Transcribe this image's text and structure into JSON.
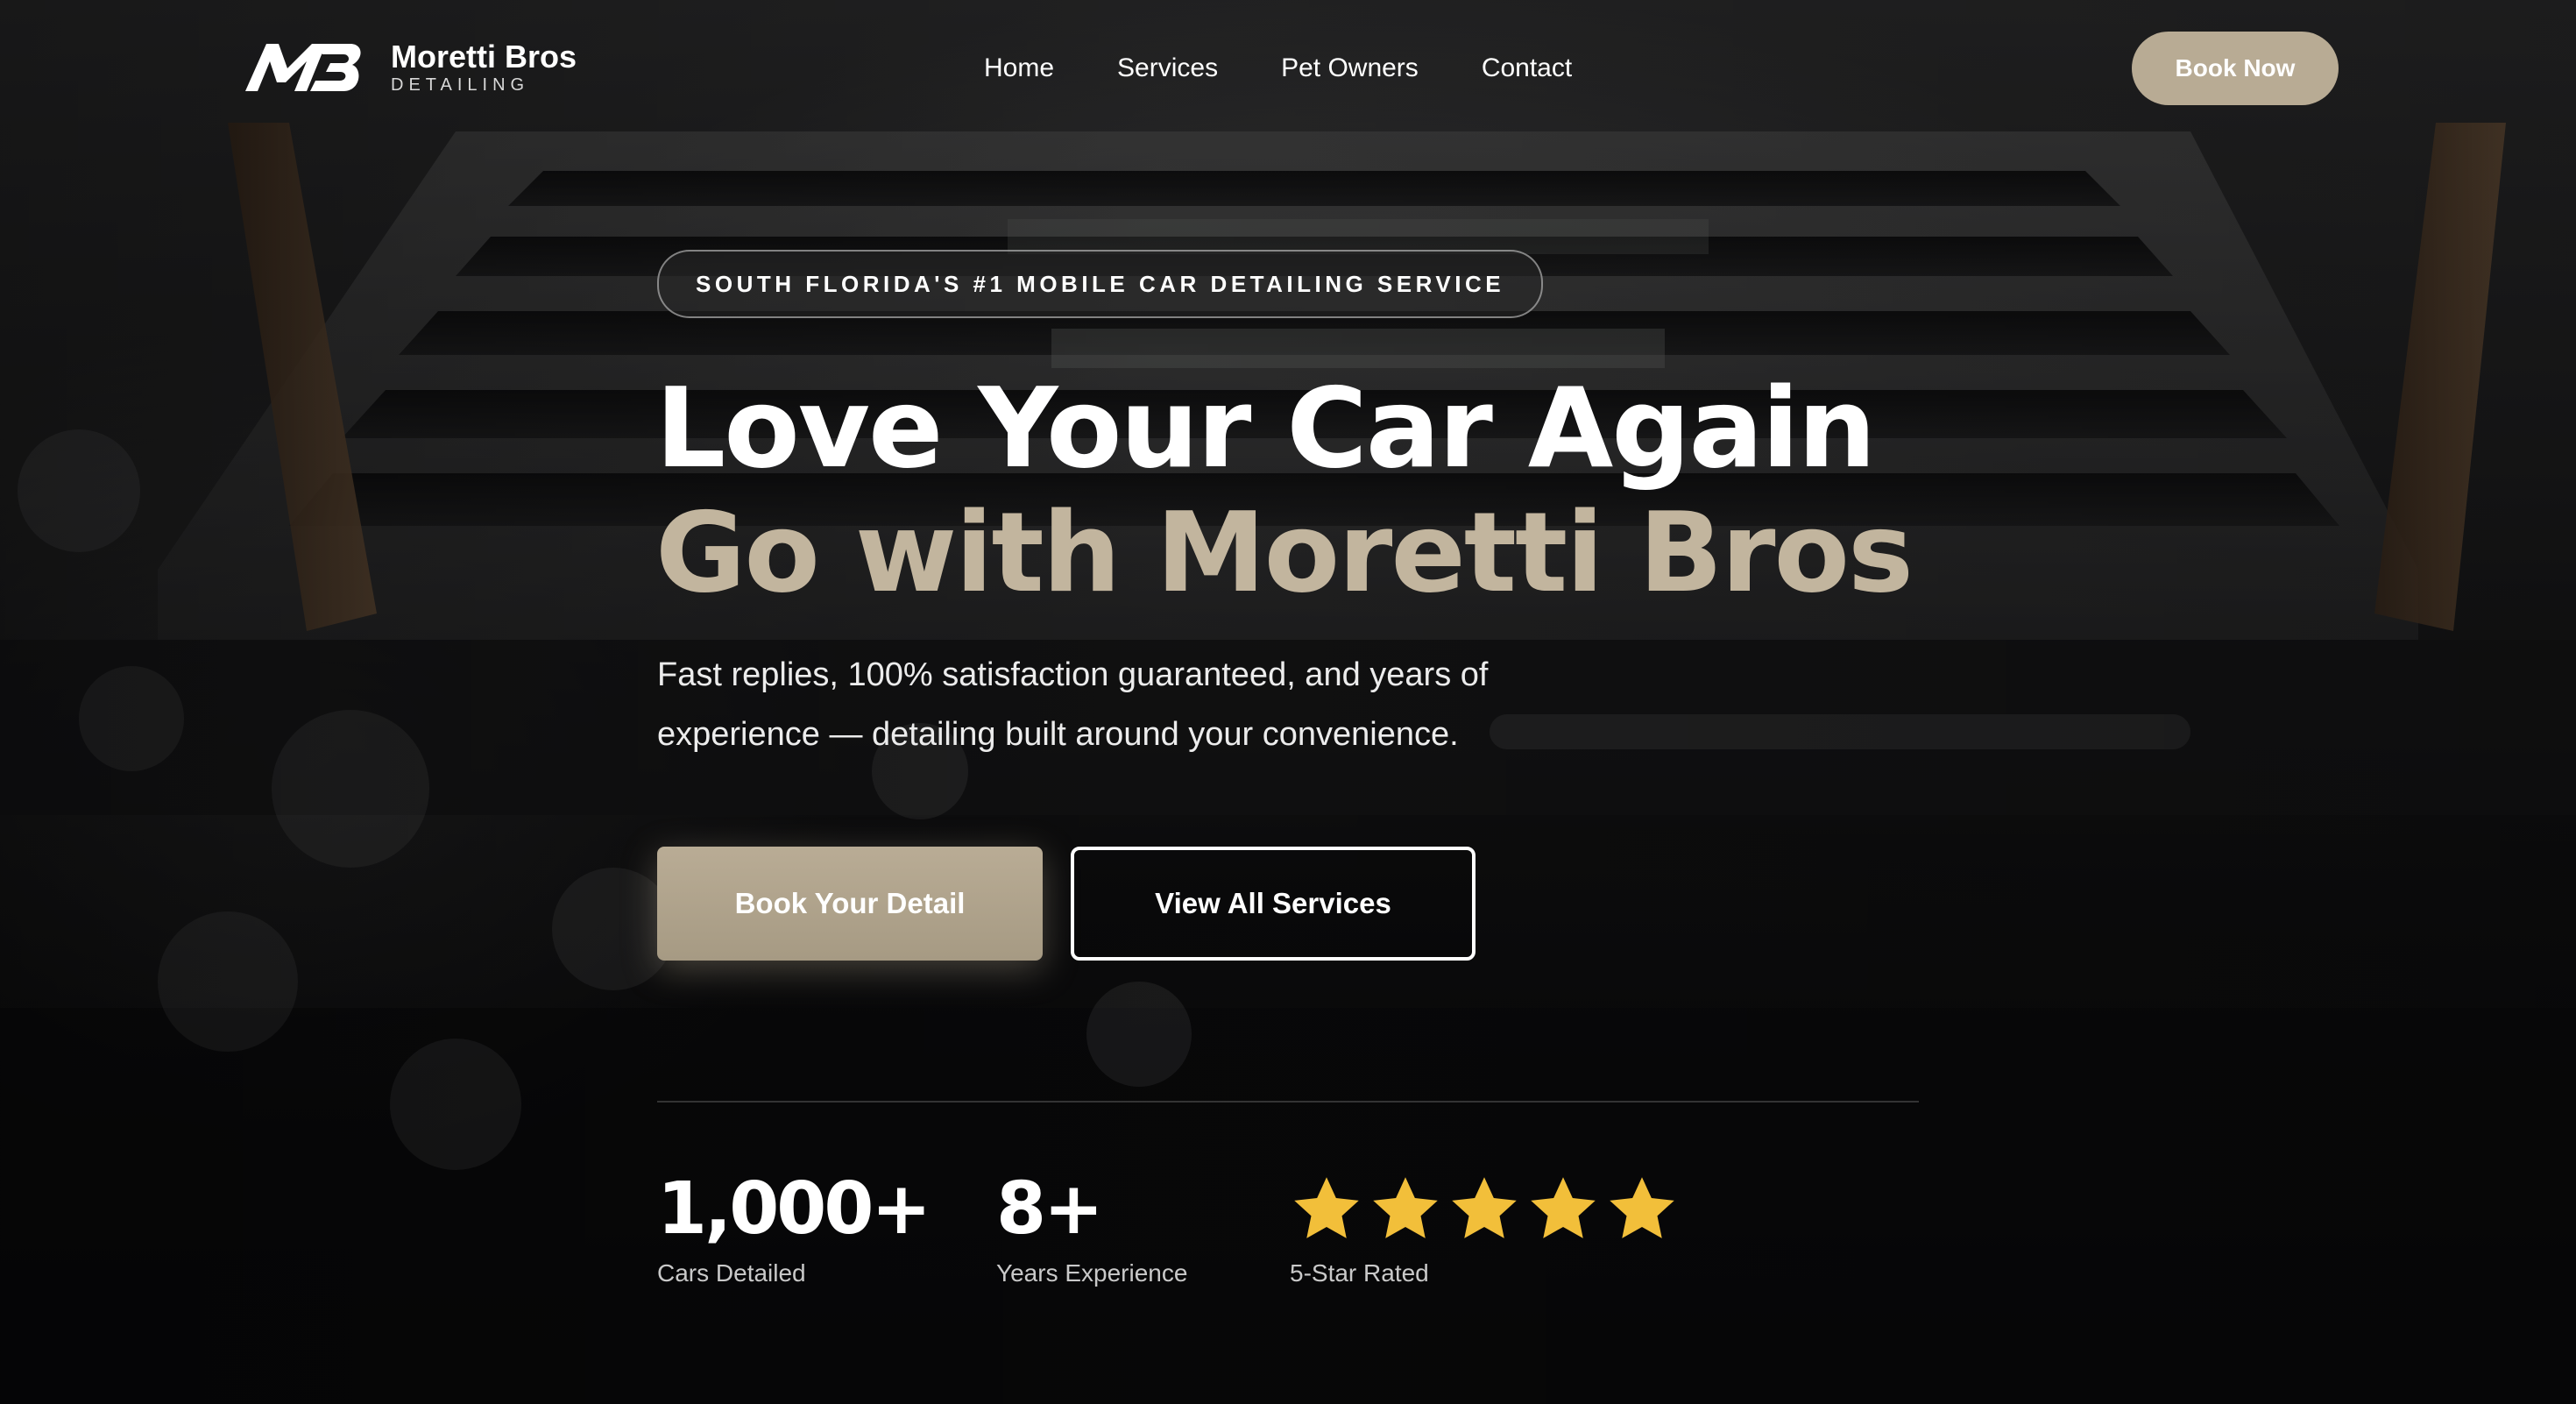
{
  "brand": {
    "name": "Moretti Bros",
    "subtitle": "DETAILING",
    "logo_icon": "mb-monogram-logo"
  },
  "nav": {
    "items": [
      {
        "label": "Home"
      },
      {
        "label": "Services"
      },
      {
        "label": "Pet Owners"
      },
      {
        "label": "Contact"
      }
    ],
    "cta_label": "Book Now"
  },
  "hero": {
    "badge": "SOUTH FLORIDA'S #1 MOBILE CAR DETAILING SERVICE",
    "headline_line1": "Love Your Car Again",
    "headline_line2": "Go with Moretti Bros",
    "subcopy": "Fast replies, 100% satisfaction guaranteed, and years of experience — detailing built around your convenience.",
    "primary_cta": "Book Your Detail",
    "secondary_cta": "View All Services",
    "background_image": "car-engine-cover-photo"
  },
  "stats": [
    {
      "value": "1,000+",
      "label": "Cars Detailed"
    },
    {
      "value": "8+",
      "label": "Years Experience"
    },
    {
      "rating": 5,
      "icon": "star-icon",
      "label": "5-Star Rated"
    }
  ],
  "colors": {
    "accent": "#b8ab94",
    "headline_accent": "#c2b59e",
    "star": "#f2bf3a",
    "background": "#0b0b0c"
  }
}
